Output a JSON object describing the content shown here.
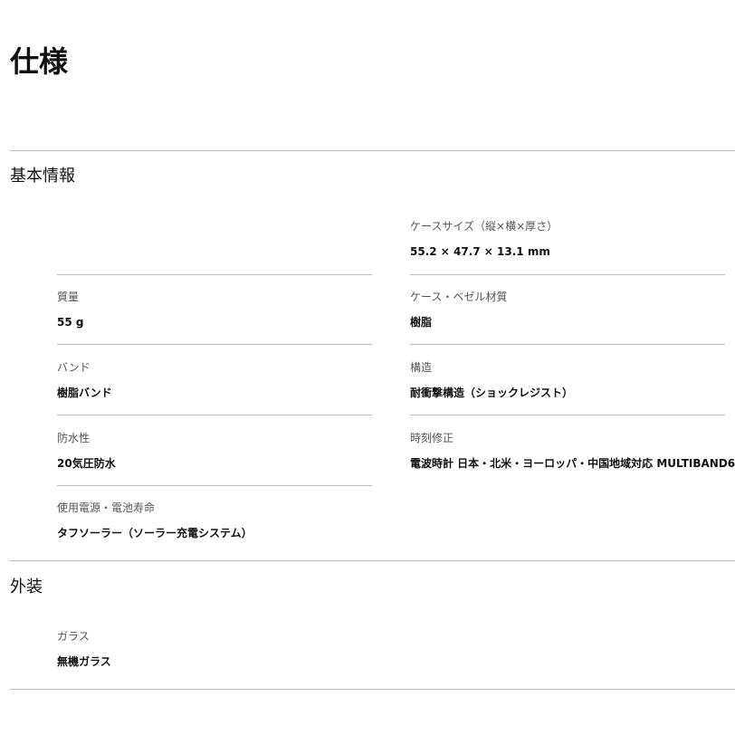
{
  "page": {
    "title": "仕様"
  },
  "sections": [
    {
      "title": "基本情報",
      "specs": [
        {
          "label": "ケースサイズ（縦×横×厚さ）",
          "value": "55.2 × 47.7 × 13.1 mm"
        },
        {
          "label": "質量",
          "value": "55 g"
        },
        {
          "label": "ケース・ベゼル材質",
          "value": "樹脂"
        },
        {
          "label": "バンド",
          "value": "樹脂バンド"
        },
        {
          "label": "構造",
          "value": "耐衝撃構造（ショックレジスト）"
        },
        {
          "label": "防水性",
          "value": "20気圧防水"
        },
        {
          "label": "時刻修正",
          "value": "電波時計 日本・北米・ヨーロッパ・中国地域対応 MULTIBAND6"
        },
        {
          "label": "使用電源・電池寿命",
          "value": "タフソーラー（ソーラー充電システム）"
        }
      ]
    },
    {
      "title": "外装",
      "specs": [
        {
          "label": "ガラス",
          "value": "無機ガラス"
        }
      ]
    }
  ]
}
